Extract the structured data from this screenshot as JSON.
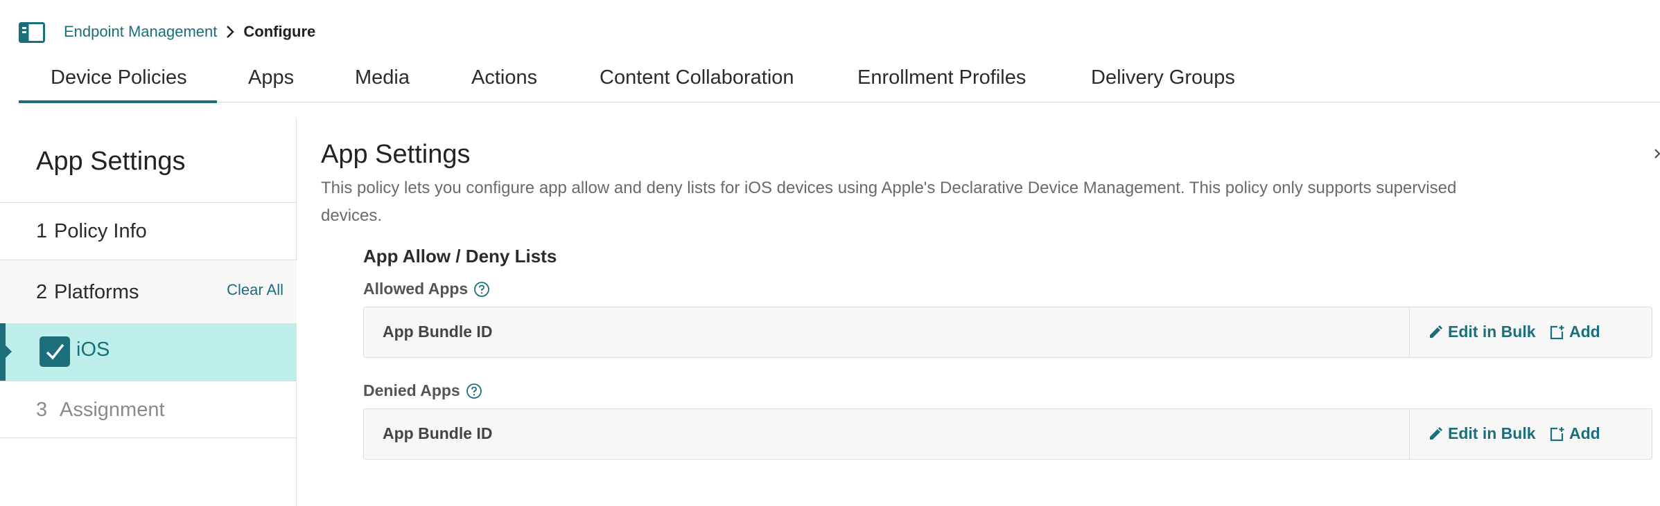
{
  "header": {
    "breadcrumb_parent": "Endpoint Management",
    "breadcrumb_current": "Configure"
  },
  "tabs": [
    {
      "label": "Device Policies",
      "active": true
    },
    {
      "label": "Apps",
      "active": false
    },
    {
      "label": "Media",
      "active": false
    },
    {
      "label": "Actions",
      "active": false
    },
    {
      "label": "Content Collaboration",
      "active": false
    },
    {
      "label": "Enrollment Profiles",
      "active": false
    },
    {
      "label": "Delivery Groups",
      "active": false
    }
  ],
  "left_nav": {
    "title": "App Settings",
    "steps": [
      {
        "number": "1",
        "label": "Policy Info"
      },
      {
        "number": "2",
        "label": "Platforms"
      },
      {
        "number": "3",
        "label": "Assignment"
      }
    ],
    "clear_all": "Clear All",
    "platform": {
      "label": "iOS",
      "checked": true
    }
  },
  "main": {
    "title": "App Settings",
    "description": "This policy lets you configure app allow and deny lists for iOS devices using Apple's Declarative Device Management. This policy only supports supervised devices.",
    "section_title": "App Allow / Deny Lists",
    "lists": [
      {
        "label": "Allowed Apps",
        "column_header": "App Bundle ID",
        "edit_label": "Edit in Bulk",
        "add_label": "Add"
      },
      {
        "label": "Denied Apps",
        "column_header": "App Bundle ID",
        "edit_label": "Edit in Bulk",
        "add_label": "Add"
      }
    ]
  },
  "colors": {
    "accent": "#1a6f7a",
    "selected_row": "#bdeee9",
    "muted_text": "#6a6a6a"
  },
  "icons": {
    "sidebar_toggle": "sidebar-toggle-icon",
    "breadcrumb_separator": "chevron-right-icon",
    "checkbox": "checkmark-icon",
    "help": "question-circle-icon",
    "edit": "pencil-icon",
    "add": "add-box-icon"
  }
}
